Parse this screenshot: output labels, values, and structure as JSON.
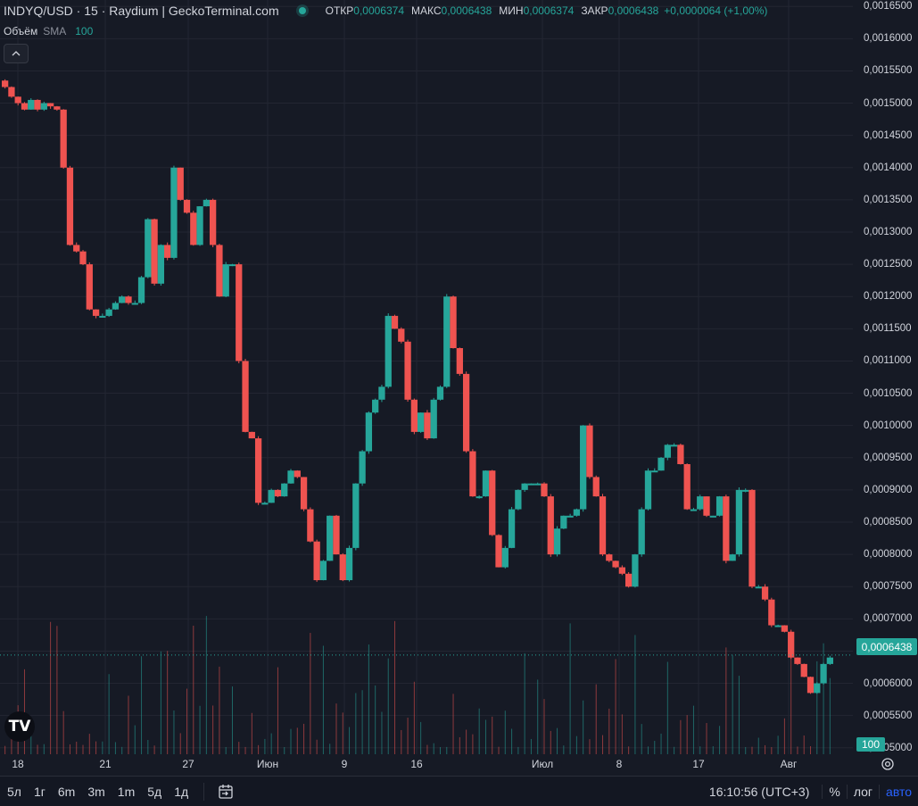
{
  "header": {
    "title": "INDYQ/USD · 15 · Raydium | GeckoTerminal.com",
    "ohlc": [
      {
        "key": "ОТКР",
        "value": "0,0006374"
      },
      {
        "key": "МАКС",
        "value": "0,0006438"
      },
      {
        "key": "МИН",
        "value": "0,0006374"
      },
      {
        "key": "ЗАКР",
        "value": "0,0006438"
      }
    ],
    "change": "+0,0000064 (+1,00%)"
  },
  "volume_legend": {
    "label": "Объём",
    "sma": "SMA",
    "value": "100"
  },
  "collapse_icon": "chevron-up-icon",
  "price_axis": {
    "labels": [
      "0,0016500",
      "0,0016000",
      "0,0015500",
      "0,0015000",
      "0,0014500",
      "0,0014000",
      "0,0013500",
      "0,0013000",
      "0,0012500",
      "0,0012000",
      "0,0011500",
      "0,0011000",
      "0,0010500",
      "0,0010000",
      "0,0009500",
      "0,0009000",
      "0,0008500",
      "0,0008000",
      "0,0007500",
      "0,0007000",
      "0,0006500",
      "0,0006000",
      "0,0005500",
      "0,0005000"
    ],
    "current_price": "0,0006438",
    "volume_badge": "100"
  },
  "time_axis": {
    "labels": [
      "18",
      "21",
      "27",
      "Июн",
      "9",
      "16",
      "Июл",
      "8",
      "17",
      "Авг"
    ]
  },
  "toolbar": {
    "timeframes": [
      "5л",
      "1г",
      "6m",
      "3m",
      "1m",
      "5д",
      "1д"
    ],
    "clock": "16:10:56 (UTC+3)",
    "percent": "%",
    "log": "лог",
    "auto": "авто"
  },
  "logo_text": "TV",
  "colors": {
    "up": "#26a69a",
    "down": "#ef5350",
    "background": "#161a25",
    "grid": "#232632"
  },
  "chart_data": {
    "type": "candlestick",
    "ylim": [
      0.00049,
      0.00166
    ],
    "x_dates": [
      "18",
      "21",
      "27",
      "Июн",
      "9",
      "16",
      "Июл",
      "8",
      "17",
      "Авг"
    ],
    "close_path": [
      0.001525,
      0.00151,
      0.0015,
      0.00149,
      0.001505,
      0.00149,
      0.0015,
      0.001495,
      0.00149,
      0.0014,
      0.00128,
      0.00127,
      0.00125,
      0.00118,
      0.00117,
      0.00117,
      0.00118,
      0.00119,
      0.0012,
      0.00119,
      0.00119,
      0.00123,
      0.00132,
      0.00122,
      0.00128,
      0.00126,
      0.0014,
      0.00135,
      0.00133,
      0.00128,
      0.00134,
      0.00135,
      0.00128,
      0.0012,
      0.00125,
      0.00125,
      0.0011,
      0.00099,
      0.00098,
      0.00088,
      0.00088,
      0.0009,
      0.00089,
      0.00091,
      0.00093,
      0.00092,
      0.00087,
      0.00082,
      0.00076,
      0.00079,
      0.00086,
      0.0008,
      0.00076,
      0.00081,
      0.00091,
      0.00096,
      0.00102,
      0.00104,
      0.00106,
      0.00117,
      0.00115,
      0.00113,
      0.00104,
      0.00099,
      0.00102,
      0.00098,
      0.00104,
      0.00106,
      0.0012,
      0.00112,
      0.00108,
      0.00096,
      0.00089,
      0.00089,
      0.00093,
      0.00083,
      0.00078,
      0.00081,
      0.00087,
      0.0009,
      0.00091,
      0.00091,
      0.00091,
      0.00089,
      0.0008,
      0.00084,
      0.00086,
      0.00086,
      0.00087,
      0.001,
      0.00092,
      0.00089,
      0.0008,
      0.00079,
      0.00078,
      0.00077,
      0.00075,
      0.0008,
      0.00087,
      0.00093,
      0.00093,
      0.00095,
      0.00097,
      0.00097,
      0.00094,
      0.00087,
      0.00087,
      0.00089,
      0.00086,
      0.00086,
      0.00089,
      0.00079,
      0.0008,
      0.0009,
      0.0009,
      0.00075,
      0.00075,
      0.00073,
      0.00069,
      0.00069,
      0.00068,
      0.00064,
      0.00063,
      0.00061,
      0.000585,
      0.0006,
      0.00063,
      0.00064
    ]
  }
}
